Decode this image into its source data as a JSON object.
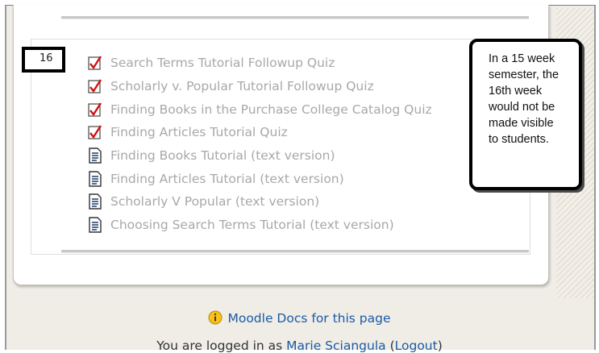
{
  "section": {
    "week_number": "16",
    "activities": [
      {
        "type": "quiz",
        "icon": "quiz-icon",
        "label": "Search Terms Tutorial Followup Quiz"
      },
      {
        "type": "quiz",
        "icon": "quiz-icon",
        "label": "Scholarly v. Popular Tutorial Followup Quiz"
      },
      {
        "type": "quiz",
        "icon": "quiz-icon",
        "label": "Finding Books in the Purchase College Catalog Quiz"
      },
      {
        "type": "quiz",
        "icon": "quiz-icon",
        "label": "Finding Articles Tutorial Quiz"
      },
      {
        "type": "page",
        "icon": "page-icon",
        "label": "Finding Books Tutorial (text version)"
      },
      {
        "type": "page",
        "icon": "page-icon",
        "label": "Finding Articles Tutorial (text version)"
      },
      {
        "type": "page",
        "icon": "page-icon",
        "label": "Scholarly V Popular (text version)"
      },
      {
        "type": "page",
        "icon": "page-icon",
        "label": "Choosing Search Terms Tutorial (text version)"
      }
    ]
  },
  "note": {
    "lines": [
      "In a 15 week",
      "semester, the",
      "16th week",
      "would not be",
      "made visible",
      "to students."
    ]
  },
  "footer": {
    "docs_label": "Moodle Docs for this page",
    "login_prefix": "You are logged in as ",
    "user_name": "Marie Sciangula",
    "logout_open": " (",
    "logout_label": "Logout",
    "logout_close": ")"
  },
  "colors": {
    "hidden_text": "#a8a8a8",
    "link": "#1a5aa6",
    "quiz_check": "#d01010"
  }
}
